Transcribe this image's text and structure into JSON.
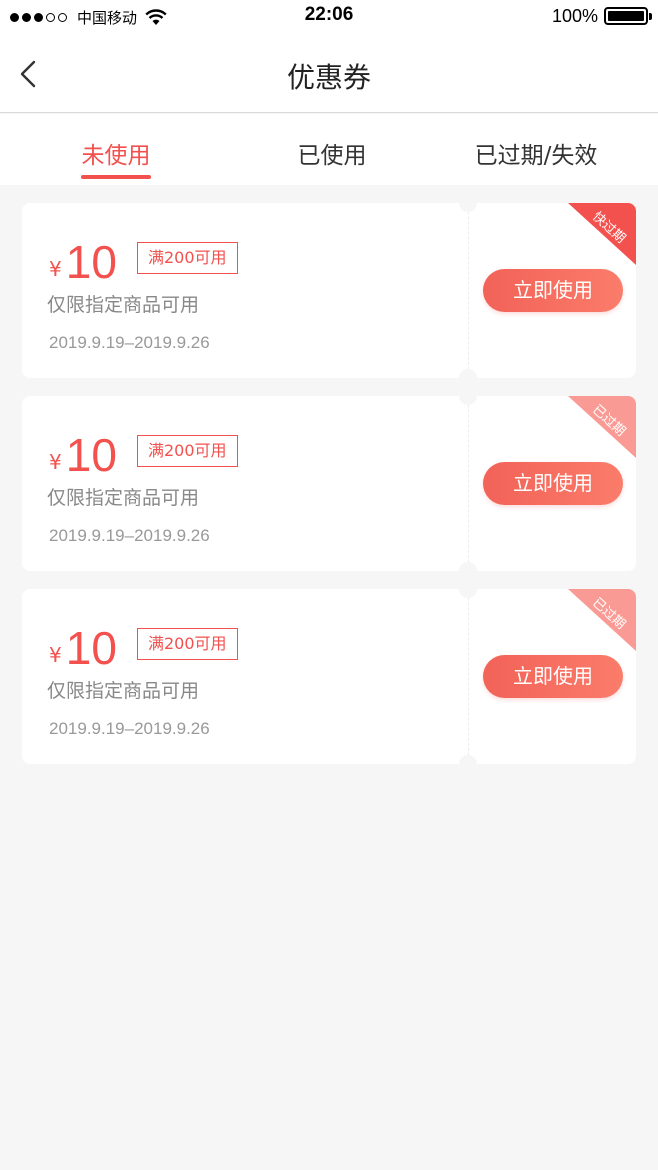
{
  "status_bar": {
    "carrier": "中国移动",
    "time": "22:06",
    "battery": "100%"
  },
  "nav": {
    "title": "优惠券",
    "back_icon": "chevron-left-icon"
  },
  "tabs": [
    {
      "label": "未使用",
      "active": true
    },
    {
      "label": "已使用",
      "active": false
    },
    {
      "label": "已过期/失效",
      "active": false
    }
  ],
  "coupons": [
    {
      "currency": "¥",
      "amount": "10",
      "condition": "满200可用",
      "description": "仅限指定商品可用",
      "date_range": "2019.9.19–2019.9.26",
      "button_label": "立即使用",
      "corner_label": "快过期"
    },
    {
      "currency": "¥",
      "amount": "10",
      "condition": "满200可用",
      "description": "仅限指定商品可用",
      "date_range": "2019.9.19–2019.9.26",
      "button_label": "立即使用",
      "corner_label": "已过期"
    },
    {
      "currency": "¥",
      "amount": "10",
      "condition": "满200可用",
      "description": "仅限指定商品可用",
      "date_range": "2019.9.19–2019.9.26",
      "button_label": "立即使用",
      "corner_label": "已过期"
    }
  ],
  "colors": {
    "accent": "#f2514e",
    "background": "#f6f6f6",
    "corner_faded": "#fa9a94"
  }
}
